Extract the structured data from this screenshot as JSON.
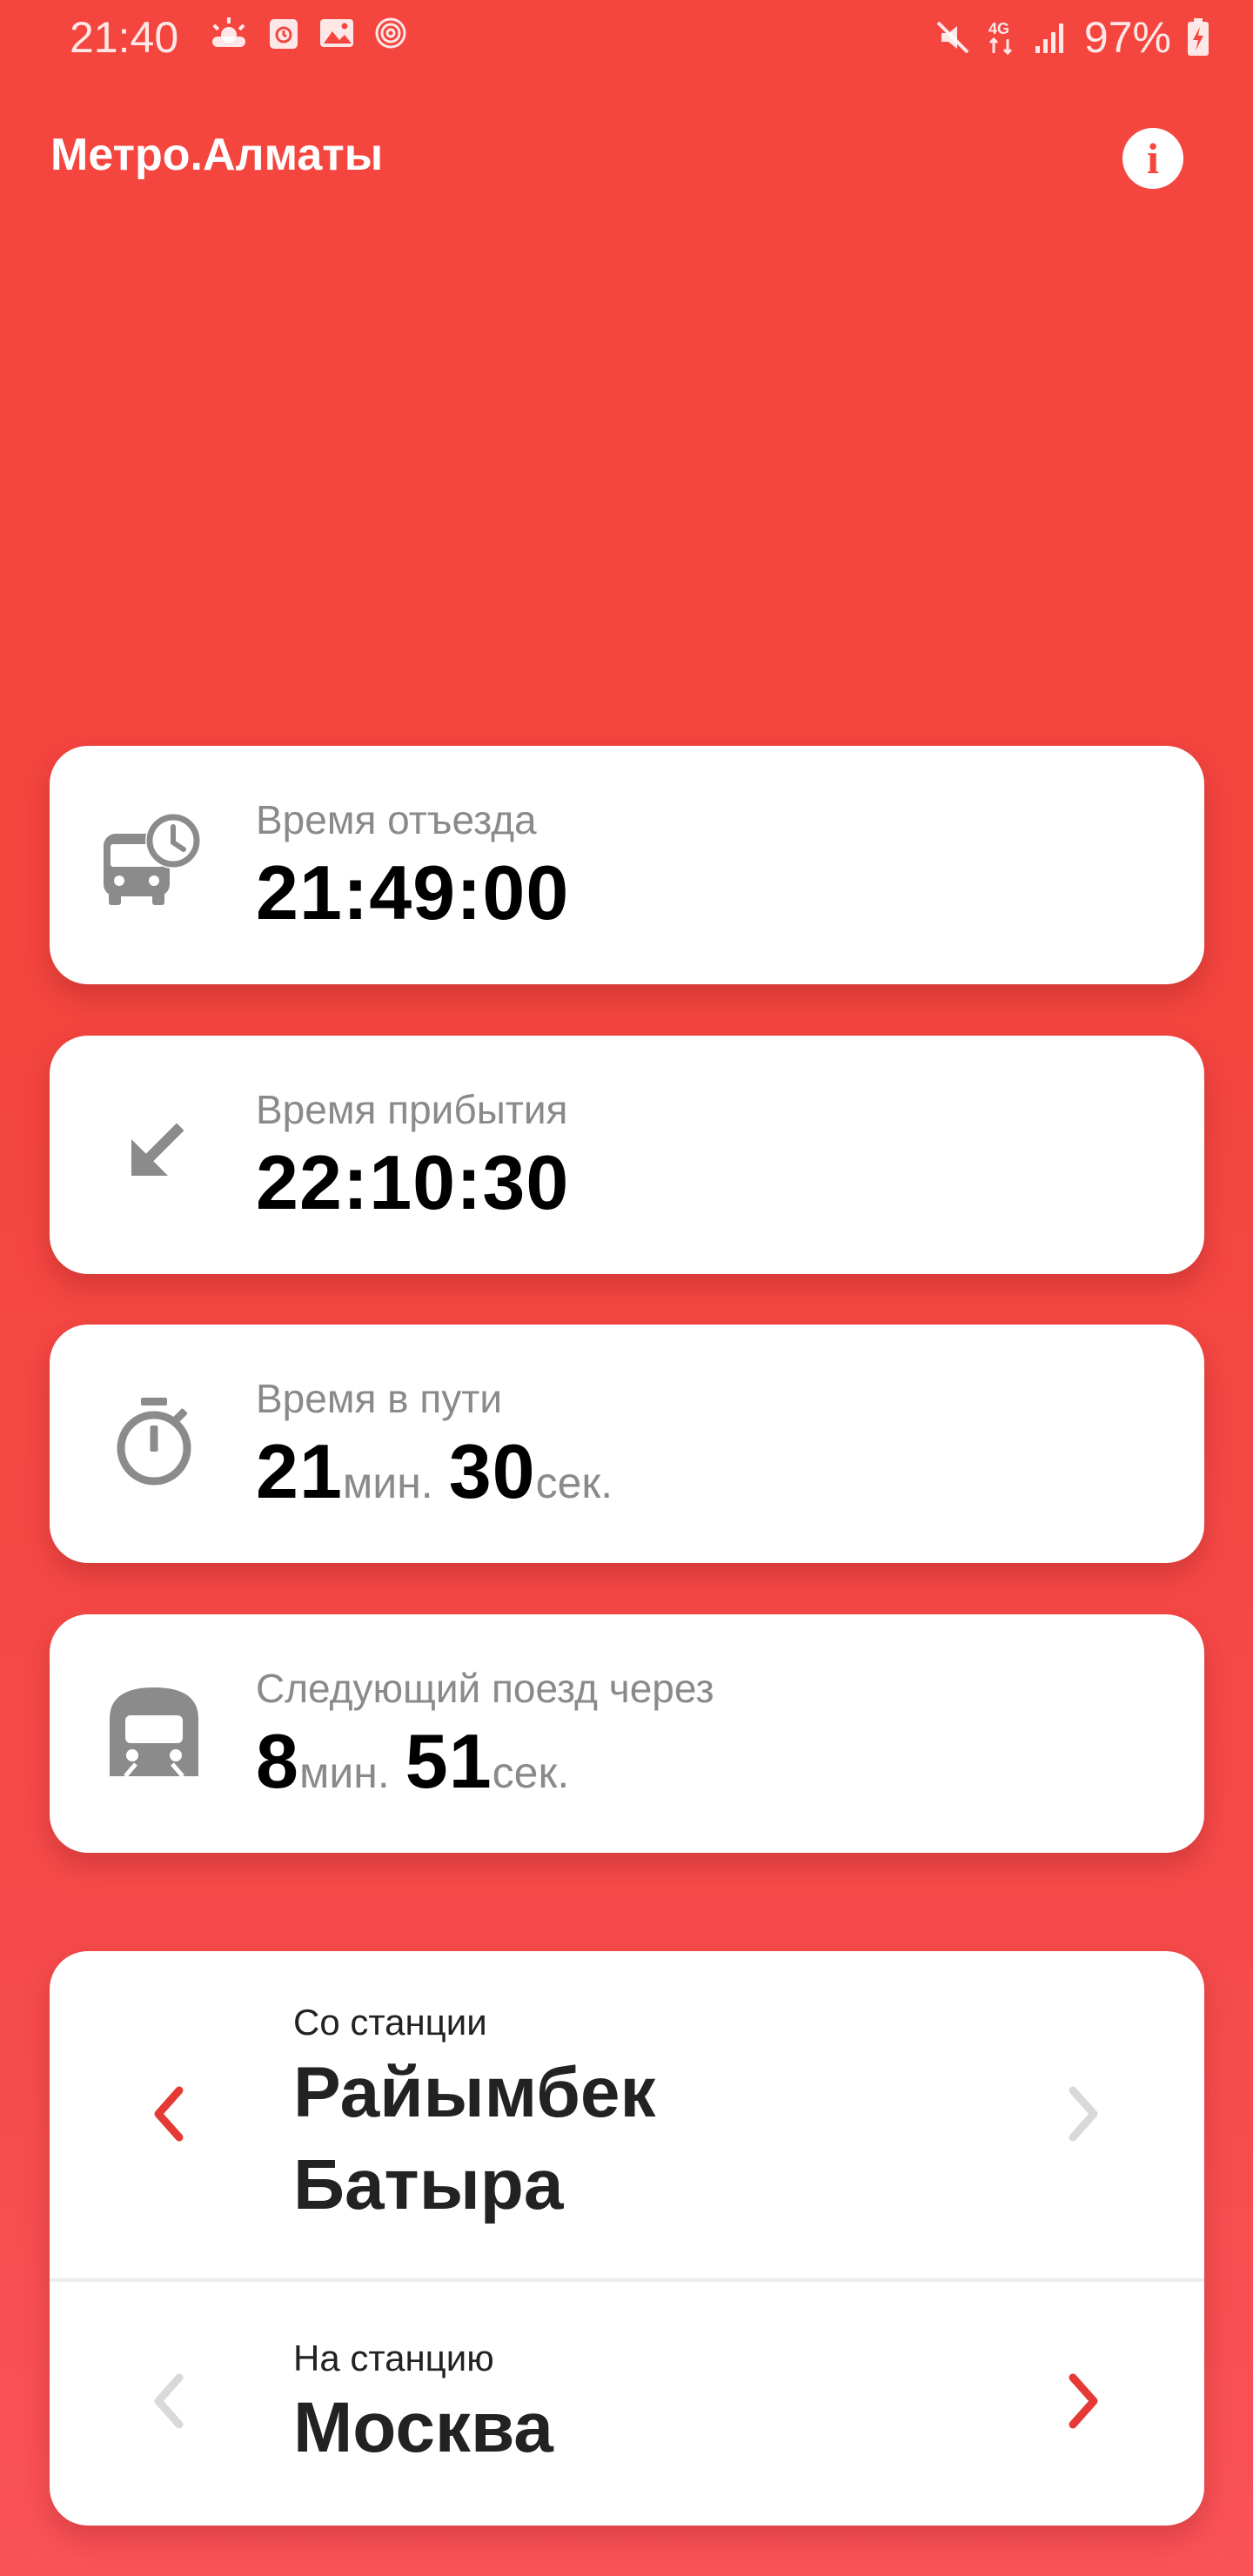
{
  "status_bar": {
    "time": "21:40",
    "network": "4G",
    "battery": "97%",
    "left_icons": [
      "weather-icon",
      "calendar-icon",
      "gallery-icon",
      "fingerprint-icon"
    ],
    "right_icons": [
      "mute-icon",
      "network-icon",
      "signal-icon",
      "battery-charging-icon"
    ]
  },
  "app": {
    "title": "Метро.Алматы",
    "info_icon": "info-icon",
    "accent": "#f4453f"
  },
  "cards": {
    "departure": {
      "label": "Время отъезда",
      "value": "21:49:00",
      "icon": "bus-clock-icon"
    },
    "arrival": {
      "label": "Время прибытия",
      "value": "22:10:30",
      "icon": "arrow-down-left-icon"
    },
    "travel": {
      "label": "Время в пути",
      "minutes": "21",
      "min_unit": "мин.",
      "seconds": "30",
      "sec_unit": "сек.",
      "icon": "stopwatch-icon"
    },
    "next_train": {
      "label": "Следующий поезд через",
      "minutes": "8",
      "min_unit": "мин.",
      "seconds": "51",
      "sec_unit": "сек.",
      "icon": "train-icon"
    }
  },
  "stations": {
    "from": {
      "caption": "Со станции",
      "name_line1": "Райымбек",
      "name_line2": "Батыра"
    },
    "to": {
      "caption": "На станцию",
      "name": "Москва"
    },
    "chevron_active_color": "#e53935",
    "chevron_disabled_color": "#d9d9d9"
  }
}
